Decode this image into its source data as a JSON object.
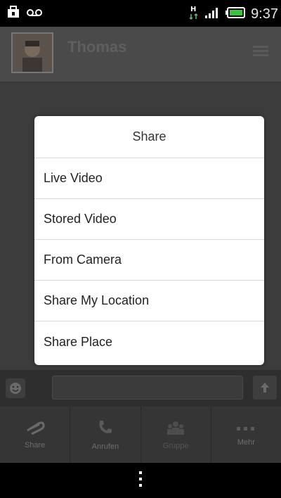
{
  "status_bar": {
    "time": "9:37",
    "network_type": "H",
    "left_icons": [
      "notification-bag-icon",
      "voicemail-icon"
    ],
    "right_icons": [
      "network-h-icon",
      "signal-icon",
      "battery-icon"
    ]
  },
  "app_bar": {
    "title": "Thomas",
    "avatar": "avatar",
    "menu_icon": "menu-icon"
  },
  "dialog": {
    "title": "Share",
    "options": [
      {
        "label": "Live Video"
      },
      {
        "label": "Stored Video"
      },
      {
        "label": "From Camera"
      },
      {
        "label": "Share My Location"
      },
      {
        "label": "Share Place"
      }
    ]
  },
  "composer": {
    "emoji_icon": "smiley-icon",
    "send_icon": "up-arrow-icon",
    "placeholder": ""
  },
  "actions": [
    {
      "label": "Share",
      "icon": "paperclip-icon"
    },
    {
      "label": "Anrufen",
      "icon": "phone-icon"
    },
    {
      "label": "Gruppe",
      "icon": "group-icon"
    },
    {
      "label": "Mehr",
      "icon": "more-icon"
    }
  ],
  "nav_bar": {
    "icon": "overflow-menu-icon"
  },
  "colors": {
    "dim_overlay": "#3c3c3c",
    "dialog_bg": "#ffffff",
    "divider": "#d8d8d8"
  }
}
